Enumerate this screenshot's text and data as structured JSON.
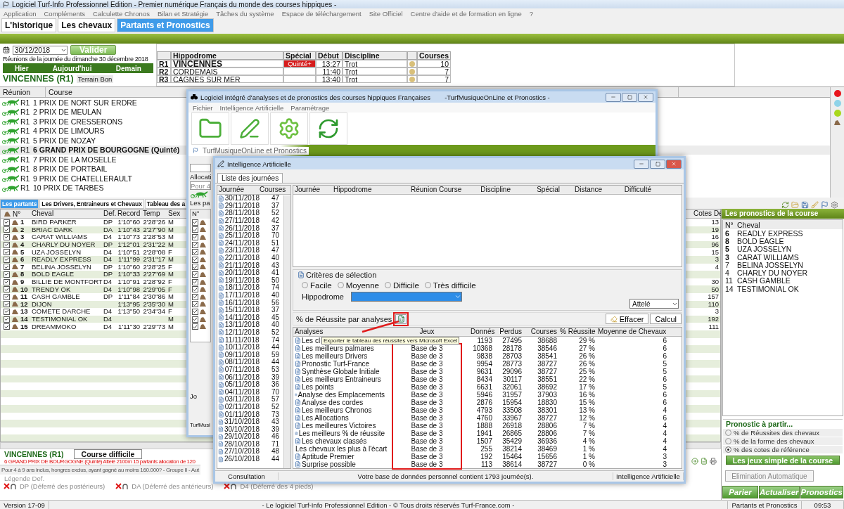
{
  "window": {
    "title": "Logiciel Turf-Info Professionnel Edition - Premier numérique Français du monde des courses hippiques -"
  },
  "menu": [
    "Application",
    "Compléments",
    "Calculette Chronos",
    "Bilan et Stratégie",
    "Tâches du système",
    "Espace de téléchargement",
    "Site Officiel",
    "Centre d'aide et de formation en ligne",
    "?"
  ],
  "tabs": [
    {
      "label": "L'historique",
      "selected": false
    },
    {
      "label": "Les chevaux",
      "selected": false
    },
    {
      "label": "Partants et Pronostics",
      "selected": true
    }
  ],
  "date_panel": {
    "date": "30/12/2018",
    "validate": "Valider",
    "caption": "Réunions de la journée du dimanche 30 décembre 2018",
    "day_buttons": [
      "Hier",
      "Aujourd'hui",
      "Demain"
    ],
    "meeting": "VINCENNES (R1)",
    "terrain": "Terrain Bon"
  },
  "meetings": {
    "columns": [
      "Hippodrome",
      "Spécial",
      "Début",
      "Discipline",
      "Courses"
    ],
    "rows": [
      {
        "id": "R1",
        "name": "VINCENNES",
        "special": "Quinté+",
        "start": "13:27",
        "discipline": "Trot",
        "courses": "10",
        "selected": true
      },
      {
        "id": "R2",
        "name": "CORDEMAIS",
        "start": "11:40",
        "discipline": "Trot",
        "courses": "7",
        "selected": false
      },
      {
        "id": "R3",
        "name": "CAGNES SUR MER",
        "start": "13:40",
        "discipline": "Trot",
        "courses": "7",
        "selected": false
      }
    ]
  },
  "races": {
    "columns": [
      "Réunion",
      "Course"
    ],
    "rows": [
      {
        "meeting": "R1",
        "name": "1 PRIX DE NORT SUR ERDRE",
        "selected": false
      },
      {
        "meeting": "R1",
        "name": "2 PRIX DE MEULAN",
        "selected": false
      },
      {
        "meeting": "R1",
        "name": "3 PRIX DE CRESSERONS",
        "selected": false
      },
      {
        "meeting": "R1",
        "name": "4 PRIX DE LIMOURS",
        "selected": false
      },
      {
        "meeting": "R1",
        "name": "5 PRIX DE NOZAY",
        "selected": false
      },
      {
        "meeting": "R1",
        "name": "6 GRAND PRIX DE BOURGOGNE (Quinté)",
        "selected": true
      },
      {
        "meeting": "R1",
        "name": "7 PRIX DE LA MOSELLE",
        "selected": false
      },
      {
        "meeting": "R1",
        "name": "8 PRIX DE PORTBAIL",
        "selected": false
      },
      {
        "meeting": "R1",
        "name": "9 PRIX DE CHATELLERAULT",
        "selected": false
      },
      {
        "meeting": "R1",
        "name": "10 PRIX DE TARBES",
        "selected": false
      }
    ]
  },
  "status_dots": [
    {
      "color": "#e8141b"
    },
    {
      "color": "#8fd3e8"
    },
    {
      "color": "#a8d81c"
    }
  ],
  "lower_tabs": [
    {
      "label": "Les partants",
      "selected": true
    },
    {
      "label": "Les Drivers, Entraineurs et Chevaux",
      "selected": false
    },
    {
      "label": "Tableau des a",
      "selected": false
    }
  ],
  "partants": {
    "columns": [
      "N°",
      "Cheval",
      "Def.",
      "Record",
      "Temp",
      "Sex",
      "Cotes De"
    ],
    "rows": [
      {
        "checked": true,
        "n": "1",
        "name": "BIRD PARKER",
        "def": "DP",
        "record": "1'10\"60",
        "temp": "2'28\"26",
        "sex": "M",
        "cote": "13"
      },
      {
        "checked": true,
        "n": "2",
        "name": "BRIAC DARK",
        "def": "DA",
        "record": "1'10\"43",
        "temp": "2'27\"90",
        "sex": "M",
        "cote": "19"
      },
      {
        "checked": true,
        "n": "3",
        "name": "CARAT WILLIAMS",
        "def": "D4",
        "record": "1'10\"73",
        "temp": "2'28\"53",
        "sex": "M",
        "cote": "16"
      },
      {
        "checked": true,
        "n": "4",
        "name": "CHARLY DU NOYER",
        "def": "DP",
        "record": "1'12\"01",
        "temp": "2'31\"22",
        "sex": "M",
        "cote": "96"
      },
      {
        "checked": true,
        "n": "5",
        "name": "UZA JOSSELYN",
        "def": "D4",
        "record": "1'10\"51",
        "temp": "2'28\"08",
        "sex": "F",
        "cote": "15"
      },
      {
        "checked": true,
        "n": "6",
        "name": "READLY EXPRESS",
        "def": "D4",
        "record": "1'11\"99",
        "temp": "2'31\"17",
        "sex": "M",
        "cote": "3"
      },
      {
        "checked": true,
        "n": "7",
        "name": "BELINA JOSSELYN",
        "def": "DP",
        "record": "1'10\"60",
        "temp": "2'28\"25",
        "sex": "F",
        "cote": "4"
      },
      {
        "checked": true,
        "n": "8",
        "name": "BOLD EAGLE",
        "def": "DP",
        "record": "1'10\"33",
        "temp": "2'27\"69",
        "sex": "M"
      },
      {
        "checked": true,
        "n": "9",
        "name": "BILLIE DE MONTFORT",
        "def": "D4",
        "record": "1'10\"91",
        "temp": "2'28\"92",
        "sex": "F",
        "cote": "30"
      },
      {
        "checked": true,
        "n": "10",
        "name": "TRENDY OK",
        "def": "D4",
        "record": "1'10\"98",
        "temp": "2'29\"05",
        "sex": "F",
        "cote": "50"
      },
      {
        "checked": true,
        "n": "11",
        "name": "CASH GAMBLE",
        "def": "DP",
        "record": "1'11\"84",
        "temp": "2'30\"86",
        "sex": "M",
        "cote": "157"
      },
      {
        "checked": true,
        "n": "12",
        "name": "DIJON",
        "record": "1'13\"95",
        "temp": "2'35\"30",
        "sex": "M",
        "cote": "110"
      },
      {
        "checked": true,
        "n": "13",
        "name": "COMETE DARCHE",
        "def": "D4",
        "record": "1'13\"50",
        "temp": "2'34\"34",
        "sex": "F",
        "cote": "3"
      },
      {
        "checked": true,
        "n": "14",
        "name": "TESTIMONIAL OK",
        "def": "D4",
        "sex": "M",
        "cote": "192"
      },
      {
        "checked": true,
        "n": "15",
        "name": "DREAMMOKO",
        "def": "D4",
        "record": "1'11\"30",
        "temp": "2'29\"73",
        "sex": "M",
        "cote": "111"
      }
    ]
  },
  "race_info": {
    "meeting": "VINCENNES (R1)",
    "difficulty": "Course difficile",
    "summary": "6 GRAND PRIX DE BOURGOGNE (Quinté) Attelé 2100m 15 partants allocation de 120",
    "conditions": "Pour 4 à 9 ans inclus, hongres exclus, ayant gagné au moins 160.000? - Groupe II - Aut",
    "legend_title": "Légende Def.",
    "legend": [
      "DP (Déferré des postérieurs)",
      "DA (Déferré des antérieurs)",
      "D4 (Déferré des 4 pieds)"
    ]
  },
  "pronostics": {
    "title": "Les pronostics de la course",
    "columns": [
      "N°",
      "Cheval"
    ],
    "rows": [
      {
        "n": "6",
        "name": "READLY EXPRESS",
        "highlighted": true
      },
      {
        "n": "8",
        "name": "BOLD EAGLE",
        "highlighted": true
      },
      {
        "n": "5",
        "name": "UZA JOSSELYN",
        "highlighted": true
      },
      {
        "n": "3",
        "name": "CARAT WILLIAMS",
        "highlighted": true
      },
      {
        "n": "7",
        "name": "BELINA JOSSELYN",
        "highlighted": false
      },
      {
        "n": "4",
        "name": "CHARLY DU NOYER",
        "highlighted": false
      },
      {
        "n": "11",
        "name": "CASH GAMBLE",
        "highlighted": false
      },
      {
        "n": "14",
        "name": "TESTIMONIAL OK",
        "highlighted": false
      }
    ],
    "source_title": "Pronostic à partir...",
    "sources": [
      {
        "label": "% de Réussites des chevaux",
        "selected": false
      },
      {
        "label": "% de la forme des chevaux",
        "selected": false
      },
      {
        "label": "% des cotes de référence",
        "selected": true
      }
    ],
    "simple_bets": "Les jeux simple de la course",
    "elimination": {
      "label": "Elimination Automatique",
      "disabled": true
    },
    "actions": [
      "Parier",
      "Actualiser",
      "Pronostics"
    ]
  },
  "status_bar": {
    "version": "Version 17-09",
    "copyright": "- Le logiciel Turf-Info Professionnel Edition - © Tous droits réservés Turf-France.com -",
    "module": "Partants et Pronostics",
    "time": "09:53"
  },
  "window_a": {
    "title": "Logiciel intégré d'analyses et de pronostics des courses hippiques Françaises",
    "subtitle": "-TurfMusiqueOnLine et Pronostics -",
    "menu": [
      "Fichier",
      "Intelligence Artificielle",
      "Paramétrage"
    ],
    "tab": "TurfMusiqueOnLine et Pronostics",
    "allocation_label": "Allocati",
    "conditions_field": "Pour 4",
    "list_tab": "Les pa",
    "number_header": "N°",
    "checks": [
      {
        "checked": true
      },
      {
        "checked": true
      },
      {
        "checked": true
      },
      {
        "checked": true
      },
      {
        "checked": true
      },
      {
        "checked": true
      },
      {
        "checked": true
      },
      {
        "checked": true
      },
      {
        "checked": true
      },
      {
        "checked": true
      },
      {
        "checked": true
      },
      {
        "checked": true
      },
      {
        "checked": true
      },
      {
        "checked": true
      },
      {
        "checked": true
      }
    ],
    "bottom_tab": "Jo",
    "status": "TurfMusi"
  },
  "window_b": {
    "title": "Intelligence Artificielle",
    "tab": "Liste des journées",
    "days": {
      "columns": [
        "Journée",
        "Courses"
      ],
      "rows": [
        {
          "date": "30/11/2018",
          "count": "47"
        },
        {
          "date": "29/11/2018",
          "count": "37"
        },
        {
          "date": "28/11/2018",
          "count": "52"
        },
        {
          "date": "27/11/2018",
          "count": "42"
        },
        {
          "date": "26/11/2018",
          "count": "37"
        },
        {
          "date": "25/11/2018",
          "count": "70"
        },
        {
          "date": "24/11/2018",
          "count": "51"
        },
        {
          "date": "23/11/2018",
          "count": "47"
        },
        {
          "date": "22/11/2018",
          "count": "40"
        },
        {
          "date": "21/11/2018",
          "count": "43"
        },
        {
          "date": "20/11/2018",
          "count": "41"
        },
        {
          "date": "19/11/2018",
          "count": "50"
        },
        {
          "date": "18/11/2018",
          "count": "74"
        },
        {
          "date": "17/11/2018",
          "count": "40"
        },
        {
          "date": "16/11/2018",
          "count": "56"
        },
        {
          "date": "15/11/2018",
          "count": "37"
        },
        {
          "date": "14/11/2018",
          "count": "45"
        },
        {
          "date": "13/11/2018",
          "count": "40"
        },
        {
          "date": "12/11/2018",
          "count": "52"
        },
        {
          "date": "11/11/2018",
          "count": "74"
        },
        {
          "date": "10/11/2018",
          "count": "44"
        },
        {
          "date": "09/11/2018",
          "count": "59"
        },
        {
          "date": "08/11/2018",
          "count": "44"
        },
        {
          "date": "07/11/2018",
          "count": "53"
        },
        {
          "date": "06/11/2018",
          "count": "39"
        },
        {
          "date": "05/11/2018",
          "count": "36"
        },
        {
          "date": "04/11/2018",
          "count": "70"
        },
        {
          "date": "03/11/2018",
          "count": "57"
        },
        {
          "date": "02/11/2018",
          "count": "52"
        },
        {
          "date": "01/11/2018",
          "count": "73"
        },
        {
          "date": "31/10/2018",
          "count": "43"
        },
        {
          "date": "30/10/2018",
          "count": "39"
        },
        {
          "date": "29/10/2018",
          "count": "46"
        },
        {
          "date": "28/10/2018",
          "count": "71"
        },
        {
          "date": "27/10/2018",
          "count": "48"
        },
        {
          "date": "26/10/2018",
          "count": "44"
        }
      ]
    },
    "detail_columns": [
      "Journée",
      "Hippodrome",
      "Réunion",
      "Course",
      "Discipline",
      "Spécial",
      "Distance",
      "Difficulté"
    ],
    "criteria": {
      "title": "Critères de sélection",
      "levels": [
        {
          "label": "Facile",
          "selected": false
        },
        {
          "label": "Moyenne",
          "selected": false
        },
        {
          "label": "Difficile",
          "selected": false
        },
        {
          "label": "Très difficile",
          "selected": false
        }
      ],
      "hippodrome_label": "Hippodrome",
      "discipline": "Attelé"
    },
    "success_label": "% de Réussite par analyses",
    "tooltip": "Exporter le tableau des réussites vers Microsoft Excel",
    "clear": "Effacer",
    "compute": "Calcul",
    "analyses": {
      "columns": [
        "Analyses",
        "Jeux",
        "Donnés",
        "Perdus",
        "Courses",
        "% Réussite",
        "Moyenne de Chevaux"
      ],
      "rows": [
        {
          "name": "Les cl",
          "won": "1193",
          "lost": "27495",
          "races": "38688",
          "rate": "29 %",
          "avg": "6"
        },
        {
          "name": "Les meilleurs palmares",
          "game": "Base de 3",
          "won": "10368",
          "lost": "28178",
          "races": "38546",
          "rate": "27 %",
          "avg": "6"
        },
        {
          "name": "Les meilleurs  Drivers",
          "game": "Base de 3",
          "won": "9838",
          "lost": "28703",
          "races": "38541",
          "rate": "26 %",
          "avg": "6"
        },
        {
          "name": "Pronostic Turf-France",
          "game": "Base de 3",
          "won": "9954",
          "lost": "28773",
          "races": "38727",
          "rate": "26 %",
          "avg": "5"
        },
        {
          "name": "Synthèse Globale Initiale",
          "game": "Base de 3",
          "won": "9631",
          "lost": "29096",
          "races": "38727",
          "rate": "25 %",
          "avg": "5"
        },
        {
          "name": "Les meilleurs Entraineurs",
          "game": "Base de 3",
          "won": "8434",
          "lost": "30117",
          "races": "38551",
          "rate": "22 %",
          "avg": "6"
        },
        {
          "name": "Les points",
          "game": "Base de 3",
          "won": "6631",
          "lost": "32061",
          "races": "38692",
          "rate": "17 %",
          "avg": "5"
        },
        {
          "name": "Analyse des Emplacements",
          "game": "Base de 3",
          "won": "5946",
          "lost": "31957",
          "races": "37903",
          "rate": "16 %",
          "avg": "6"
        },
        {
          "name": "Analyse des cordes",
          "game": "Base de 3",
          "won": "2876",
          "lost": "15954",
          "races": "18830",
          "rate": "15 %",
          "avg": "6"
        },
        {
          "name": "Les meilleurs Chronos",
          "game": "Base de 3",
          "won": "4793",
          "lost": "33508",
          "races": "38301",
          "rate": "13 %",
          "avg": "4"
        },
        {
          "name": "Les Allocations",
          "game": "Base de 3",
          "won": "4760",
          "lost": "33967",
          "races": "38727",
          "rate": "12 %",
          "avg": "6"
        },
        {
          "name": "Les meilleures Victoires",
          "game": "Base de 3",
          "won": "1888",
          "lost": "26918",
          "races": "28806",
          "rate": "7 %",
          "avg": "4"
        },
        {
          "name": "Les meilleurs % de réussite",
          "game": "Base de 3",
          "won": "1941",
          "lost": "26865",
          "races": "28806",
          "rate": "7 %",
          "avg": "4"
        },
        {
          "name": "Les chevaux classés",
          "game": "Base de 3",
          "won": "1507",
          "lost": "35429",
          "races": "36936",
          "rate": "4 %",
          "avg": "4"
        },
        {
          "name": "Les chevaux les plus à l'écart",
          "game": "Base de 3",
          "won": "255",
          "lost": "38214",
          "races": "38469",
          "rate": "1 %",
          "avg": "4"
        },
        {
          "name": "Aptitude Premier",
          "game": "Base de 3",
          "won": "192",
          "lost": "15464",
          "races": "15656",
          "rate": "1 %",
          "avg": "3"
        },
        {
          "name": "Surprise possible",
          "game": "Base de 3",
          "won": "113",
          "lost": "38614",
          "races": "38727",
          "rate": "0 %",
          "avg": "3"
        }
      ]
    },
    "status": [
      "Consultation",
      "Votre base de données personnel contient 1793 journée(s).",
      "Intelligence Artificielle"
    ]
  }
}
